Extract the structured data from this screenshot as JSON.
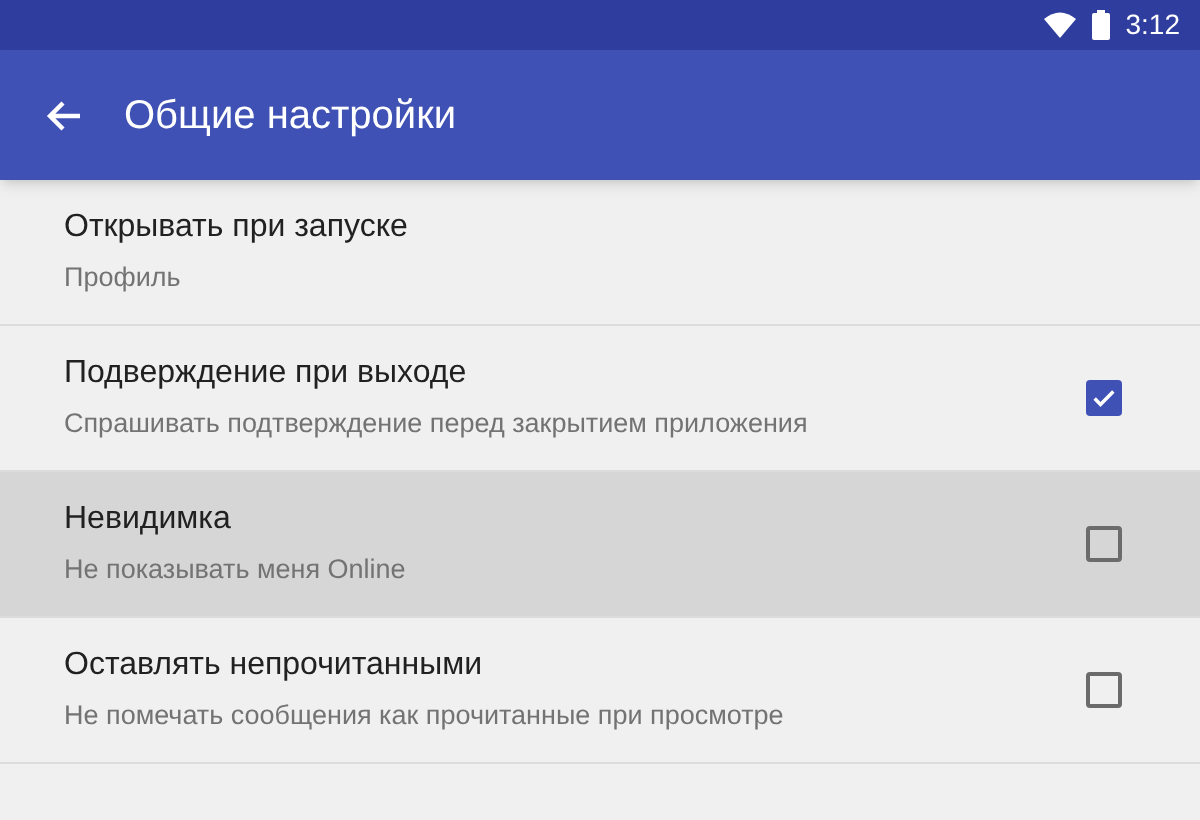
{
  "status_bar": {
    "time": "3:12"
  },
  "app_bar": {
    "title": "Общие настройки"
  },
  "settings": [
    {
      "kind": "text",
      "title": "Открывать при запуске",
      "summary": "Профиль",
      "pressed": false
    },
    {
      "kind": "checkbox",
      "title": "Подверждение при выходе",
      "summary": "Спрашивать подтверждение перед закрытием приложения",
      "checked": true,
      "pressed": false
    },
    {
      "kind": "checkbox",
      "title": "Невидимка",
      "summary": "Не показывать меня Online",
      "checked": false,
      "pressed": true
    },
    {
      "kind": "checkbox",
      "title": "Оставлять непрочитанными",
      "summary": "Не помечать сообщения как прочитанные при просмотре",
      "checked": false,
      "pressed": false
    }
  ]
}
